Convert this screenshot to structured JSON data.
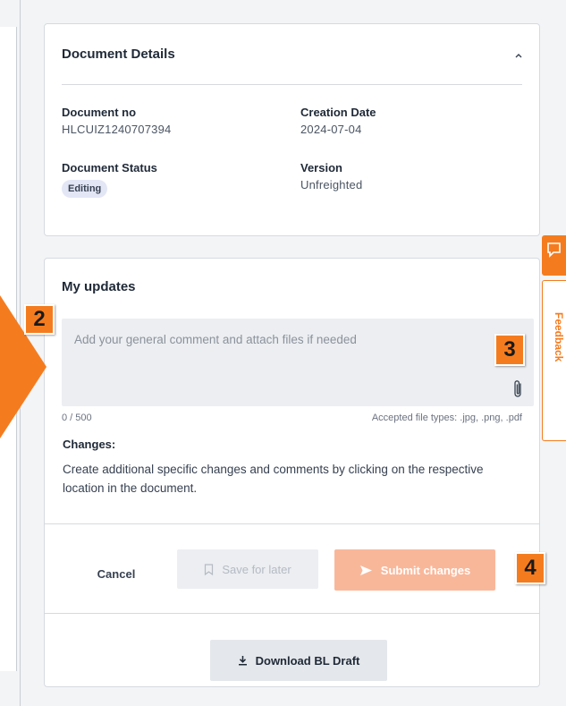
{
  "details": {
    "title": "Document Details",
    "doc_no_label": "Document no",
    "doc_no_value": "HLCUIZ1240707394",
    "creation_label": "Creation Date",
    "creation_value": "2024-07-04",
    "status_label": "Document Status",
    "status_value": "Editing",
    "version_label": "Version",
    "version_value": "Unfreighted"
  },
  "updates": {
    "title": "My updates",
    "comment_placeholder": "Add your general comment and attach files if needed",
    "char_count": "0 / 500",
    "accepted_types": "Accepted file types: .jpg, .png, .pdf",
    "changes_label": "Changes:",
    "changes_desc": "Create additional specific changes and comments by clicking on the respective location in the document."
  },
  "actions": {
    "cancel": "Cancel",
    "save_later": "Save for later",
    "submit": "Submit changes",
    "download": "Download BL Draft"
  },
  "annotations": {
    "step2": "2",
    "step3": "3",
    "step4": "4"
  },
  "feedback": {
    "label": "Feedback"
  },
  "colors": {
    "accent": "#f47c1f",
    "submit_disabled": "#f9b79a",
    "badge_bg": "#e3e6f5"
  },
  "icons": [
    "chevron-up-icon",
    "paperclip-icon",
    "bookmark-icon",
    "send-icon",
    "download-icon",
    "feedback-icon"
  ]
}
